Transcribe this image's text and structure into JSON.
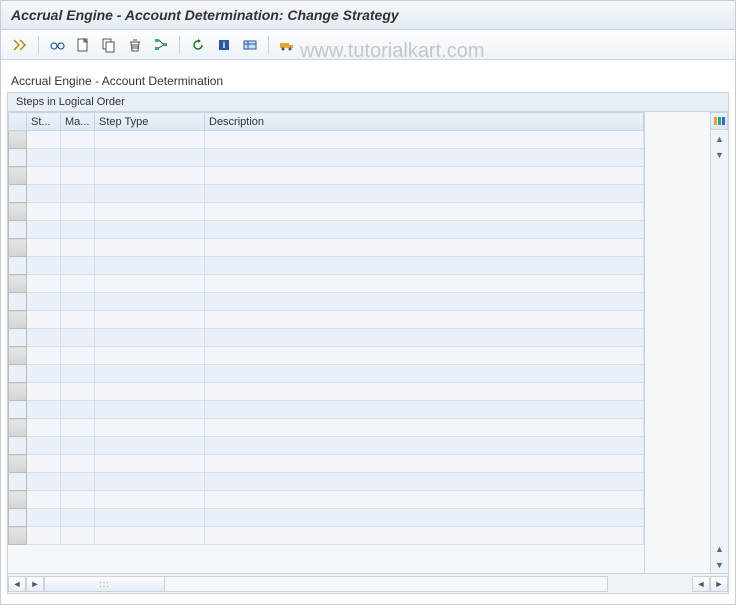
{
  "title": "Accrual Engine - Account Determination: Change Strategy",
  "watermark": "www.tutorialkart.com",
  "subheading": "Accrual Engine - Account Determination",
  "panel_title": "Steps in Logical Order",
  "columns": {
    "selector": "",
    "step": "St...",
    "manual": "Ma...",
    "step_type": "Step Type",
    "description": "Description"
  },
  "rows": [
    {
      "step": "",
      "manual": "",
      "step_type": "",
      "description": ""
    },
    {
      "step": "",
      "manual": "",
      "step_type": "",
      "description": ""
    },
    {
      "step": "",
      "manual": "",
      "step_type": "",
      "description": ""
    },
    {
      "step": "",
      "manual": "",
      "step_type": "",
      "description": ""
    },
    {
      "step": "",
      "manual": "",
      "step_type": "",
      "description": ""
    },
    {
      "step": "",
      "manual": "",
      "step_type": "",
      "description": ""
    },
    {
      "step": "",
      "manual": "",
      "step_type": "",
      "description": ""
    },
    {
      "step": "",
      "manual": "",
      "step_type": "",
      "description": ""
    },
    {
      "step": "",
      "manual": "",
      "step_type": "",
      "description": ""
    },
    {
      "step": "",
      "manual": "",
      "step_type": "",
      "description": ""
    },
    {
      "step": "",
      "manual": "",
      "step_type": "",
      "description": ""
    },
    {
      "step": "",
      "manual": "",
      "step_type": "",
      "description": ""
    },
    {
      "step": "",
      "manual": "",
      "step_type": "",
      "description": ""
    },
    {
      "step": "",
      "manual": "",
      "step_type": "",
      "description": ""
    },
    {
      "step": "",
      "manual": "",
      "step_type": "",
      "description": ""
    },
    {
      "step": "",
      "manual": "",
      "step_type": "",
      "description": ""
    },
    {
      "step": "",
      "manual": "",
      "step_type": "",
      "description": ""
    },
    {
      "step": "",
      "manual": "",
      "step_type": "",
      "description": ""
    },
    {
      "step": "",
      "manual": "",
      "step_type": "",
      "description": ""
    },
    {
      "step": "",
      "manual": "",
      "step_type": "",
      "description": ""
    },
    {
      "step": "",
      "manual": "",
      "step_type": "",
      "description": ""
    },
    {
      "step": "",
      "manual": "",
      "step_type": "",
      "description": ""
    },
    {
      "step": "",
      "manual": "",
      "step_type": "",
      "description": ""
    }
  ],
  "toolbar_icons": [
    "toggle-icon",
    "sep",
    "glasses-icon",
    "new-icon",
    "copy-icon",
    "delete-icon",
    "tree-icon",
    "sep",
    "undo-icon",
    "info-icon",
    "settings-icon",
    "sep",
    "transport-icon"
  ]
}
